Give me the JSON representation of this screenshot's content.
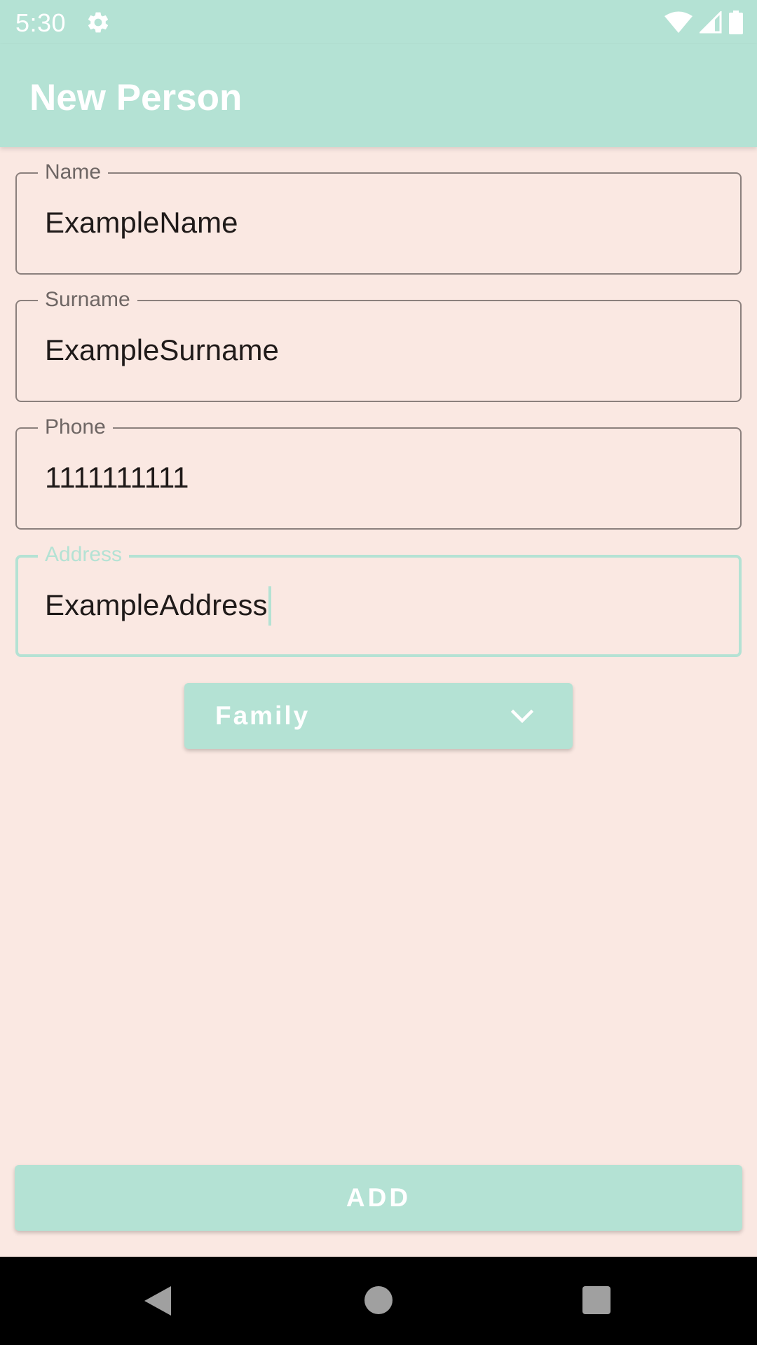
{
  "status_bar": {
    "time": "5:30",
    "icons": [
      "gear-icon",
      "wifi-icon",
      "cellular-signal-icon",
      "battery-icon"
    ]
  },
  "app_bar": {
    "title": "New Person"
  },
  "form": {
    "fields": [
      {
        "label": "Name",
        "value": "ExampleName"
      },
      {
        "label": "Surname",
        "value": "ExampleSurname"
      },
      {
        "label": "Phone",
        "value": "1111111111"
      },
      {
        "label": "Address",
        "value": "ExampleAddress",
        "focused": true
      }
    ],
    "category_dropdown": {
      "selected": "Family",
      "icon": "chevron-down-icon"
    },
    "submit_label": "ADD"
  },
  "nav_bar": {
    "icons": [
      "back-icon",
      "home-icon",
      "recents-icon"
    ]
  },
  "colors": {
    "accent": "#B4E2D4",
    "background": "#FAE8E2",
    "outline": "#8B807D",
    "text": "#1F1A19"
  }
}
